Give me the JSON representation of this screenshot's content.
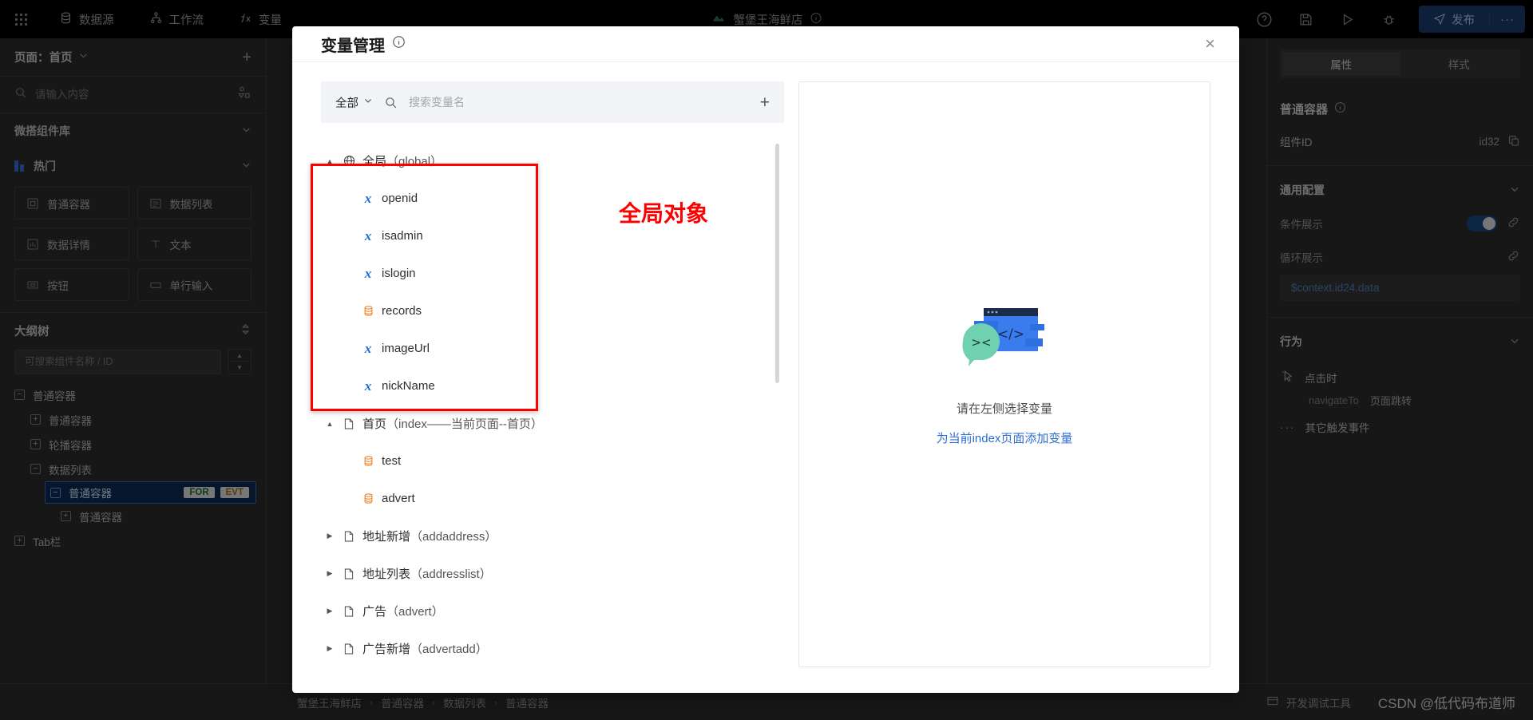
{
  "toolbar": {
    "left_items": [
      {
        "icon": "database-icon",
        "label": "数据源"
      },
      {
        "icon": "workflow-icon",
        "label": "工作流"
      },
      {
        "icon": "fx-icon",
        "label": "变量"
      }
    ],
    "center_title": "蟹堡王海鲜店",
    "publish_label": "发布",
    "more_label": "···"
  },
  "left_panel": {
    "page_label": "页面：首页",
    "search_placeholder": "请输入内容",
    "library_title": "微搭组件库",
    "hot_title": "热门",
    "components": [
      {
        "label": "普通容器",
        "icon": "container-icon"
      },
      {
        "label": "数据列表",
        "icon": "list-icon"
      },
      {
        "label": "数据详情",
        "icon": "detail-icon"
      },
      {
        "label": "文本",
        "icon": "text-icon"
      },
      {
        "label": "按钮",
        "icon": "button-icon"
      },
      {
        "label": "单行输入",
        "icon": "input-icon"
      }
    ],
    "outline_title": "大纲树",
    "outline_search_placeholder": "可搜索组件名称 / ID",
    "outline_nodes": [
      {
        "label": "普通容器",
        "box": "−",
        "indent": 0,
        "selected": false
      },
      {
        "label": "普通容器",
        "box": "+",
        "indent": 1,
        "selected": false
      },
      {
        "label": "轮播容器",
        "box": "+",
        "indent": 1,
        "selected": false
      },
      {
        "label": "数据列表",
        "box": "−",
        "indent": 1,
        "selected": false
      },
      {
        "label": "普通容器",
        "box": "−",
        "indent": 2,
        "selected": true,
        "badges": [
          "FOR",
          "EVT"
        ]
      },
      {
        "label": "普通容器",
        "box": "+",
        "indent": 3,
        "selected": false
      },
      {
        "label": "Tab栏",
        "box": "+",
        "indent": 0,
        "selected": false
      }
    ]
  },
  "right_panel": {
    "tabs": [
      {
        "label": "属性",
        "active": true
      },
      {
        "label": "样式",
        "active": false
      }
    ],
    "component_title": "普通容器",
    "component_id_label": "组件ID",
    "component_id_value": "id32",
    "general_section": "通用配置",
    "condition_label": "条件展示",
    "loop_label": "循环展示",
    "loop_value": "$context.id24.data",
    "behavior_section": "行为",
    "event_label": "点击时",
    "event_key": "navigateTo",
    "event_desc": "页面跳转",
    "other_events_label": "其它触发事件"
  },
  "bottom_bar": {
    "breadcrumbs": [
      "蟹堡王海鲜店",
      "普通容器",
      "数据列表",
      "普通容器"
    ],
    "devtool_label": "开发调试工具",
    "watermark": "CSDN @低代码布道师"
  },
  "modal": {
    "title": "变量管理",
    "close_label": "×",
    "filter_label": "全部",
    "search_placeholder": "搜索变量名",
    "add_label": "+",
    "tree": [
      {
        "label": "全局",
        "paren": "（global）",
        "icon": "globe-icon",
        "expanded": true,
        "children": [
          {
            "label": "openid",
            "icon": "x-var-icon"
          },
          {
            "label": "isadmin",
            "icon": "x-var-icon"
          },
          {
            "label": "islogin",
            "icon": "x-var-icon"
          },
          {
            "label": "records",
            "icon": "object-icon"
          },
          {
            "label": "imageUrl",
            "icon": "x-var-icon"
          },
          {
            "label": "nickName",
            "icon": "x-var-icon"
          }
        ]
      },
      {
        "label": "首页",
        "paren": "（index——当前页面--首页）",
        "icon": "page-icon",
        "expanded": true,
        "children": [
          {
            "label": "test",
            "icon": "object-icon"
          },
          {
            "label": "advert",
            "icon": "object-icon"
          }
        ]
      },
      {
        "label": "地址新增",
        "paren": "（addaddress）",
        "icon": "page-icon",
        "expanded": false,
        "children": []
      },
      {
        "label": "地址列表",
        "paren": "（addresslist）",
        "icon": "page-icon",
        "expanded": false,
        "children": []
      },
      {
        "label": "广告",
        "paren": "（advert）",
        "icon": "page-icon",
        "expanded": false,
        "children": []
      },
      {
        "label": "广告新增",
        "paren": "（advertadd）",
        "icon": "page-icon",
        "expanded": false,
        "children": []
      }
    ],
    "empty_text": "请在左侧选择变量",
    "empty_link": "为当前index页面添加变量"
  },
  "annotation": {
    "label": "全局对象",
    "color": "#ff0000"
  }
}
